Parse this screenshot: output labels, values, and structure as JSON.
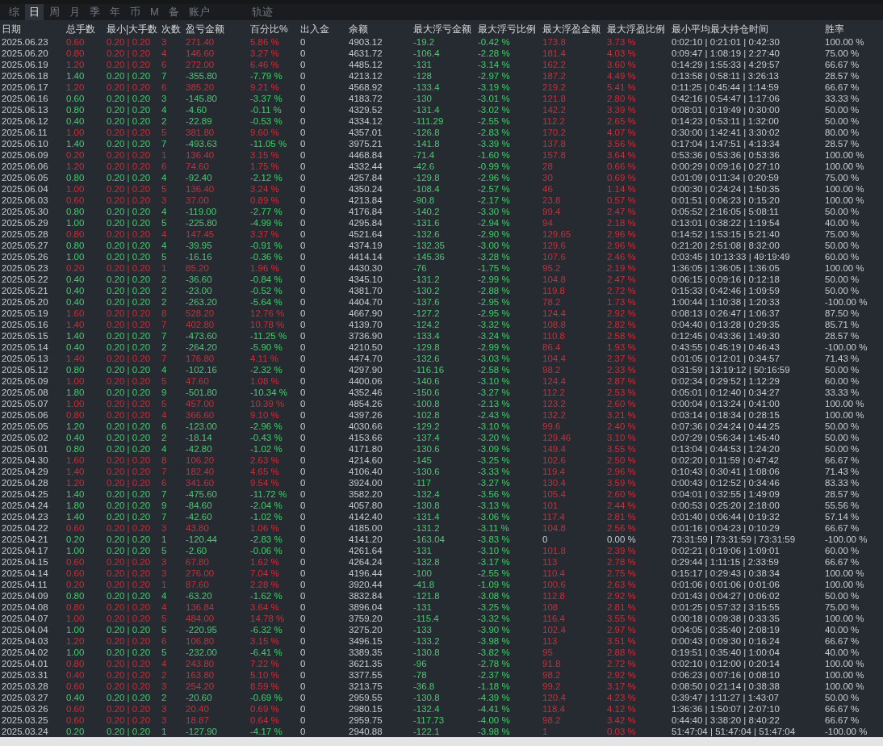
{
  "tabs": [
    {
      "label": "综",
      "selected": false
    },
    {
      "label": "日",
      "selected": true
    },
    {
      "label": "周",
      "selected": false
    },
    {
      "label": "月",
      "selected": false
    },
    {
      "label": "季",
      "selected": false
    },
    {
      "label": "年",
      "selected": false
    },
    {
      "label": "币",
      "selected": false
    },
    {
      "label": "M",
      "selected": false
    },
    {
      "label": "备",
      "selected": false
    },
    {
      "label": "账户",
      "selected": false
    }
  ],
  "extra_tab": {
    "label": "轨迹",
    "selected": false
  },
  "table": {
    "columns": [
      "日期",
      "总手数",
      "最小|大手数",
      "次数",
      "盈亏金额",
      "百分比%",
      "出入金",
      "余额",
      "最大浮亏金额",
      "最大浮亏比例",
      "最大浮盈金额",
      "最大浮盈比例",
      "最小平均最大持仓时间",
      "胜率"
    ],
    "rows": [
      {
        "kind": "win",
        "float_flat": false,
        "cells": [
          "2025.06.23",
          "0.60",
          "0.20 | 0.20",
          "3",
          "271.40",
          "5.86 %",
          "0",
          "4903.12",
          "-19.2",
          "-0.42 %",
          "173.8",
          "3.73 %",
          "0:02:10 | 0:21:01 | 0:42:30",
          "100.00 %"
        ]
      },
      {
        "kind": "win",
        "float_flat": false,
        "cells": [
          "2025.06.20",
          "0.80",
          "0.20 | 0.20",
          "4",
          "146.60",
          "3.27 %",
          "0",
          "4631.72",
          "-106.4",
          "-2.28 %",
          "181.4",
          "4.03 %",
          "0:09:47 | 1:08:19 | 2:27:40",
          "75.00 %"
        ]
      },
      {
        "kind": "win",
        "float_flat": false,
        "cells": [
          "2025.06.19",
          "1.20",
          "0.20 | 0.20",
          "6",
          "272.00",
          "6.46 %",
          "0",
          "4485.12",
          "-131",
          "-3.14 %",
          "162.2",
          "3.60 %",
          "0:14:29 | 1:55:33 | 4:29:57",
          "66.67 %"
        ]
      },
      {
        "kind": "loss",
        "float_flat": false,
        "cells": [
          "2025.06.18",
          "1.40",
          "0.20 | 0.20",
          "7",
          "-355.80",
          "-7.79 %",
          "0",
          "4213.12",
          "-128",
          "-2.97 %",
          "187.2",
          "4.49 %",
          "0:13:58 | 0:58:11 | 3:26:13",
          "28.57 %"
        ]
      },
      {
        "kind": "win",
        "float_flat": false,
        "cells": [
          "2025.06.17",
          "1.20",
          "0.20 | 0.20",
          "6",
          "385.20",
          "9.21 %",
          "0",
          "4568.92",
          "-133.4",
          "-3.19 %",
          "219.2",
          "5.41 %",
          "0:11:25 | 0:45:44 | 1:14:59",
          "66.67 %"
        ]
      },
      {
        "kind": "loss",
        "float_flat": false,
        "cells": [
          "2025.06.16",
          "0.60",
          "0.20 | 0.20",
          "3",
          "-145.80",
          "-3.37 %",
          "0",
          "4183.72",
          "-130",
          "-3.01 %",
          "121.8",
          "2.80 %",
          "0:42:16 | 0:54:47 | 1:17:06",
          "33.33 %"
        ]
      },
      {
        "kind": "loss",
        "float_flat": false,
        "cells": [
          "2025.06.13",
          "0.80",
          "0.20 | 0.20",
          "4",
          "-4.60",
          "-0.11 %",
          "0",
          "4329.52",
          "-131.4",
          "-3.02 %",
          "142.2",
          "3.39 %",
          "0:08:01 | 0:19:49 | 0:30:00",
          "50.00 %"
        ]
      },
      {
        "kind": "loss",
        "float_flat": false,
        "cells": [
          "2025.06.12",
          "0.40",
          "0.20 | 0.20",
          "2",
          "-22.89",
          "-0.53 %",
          "0",
          "4334.12",
          "-111.29",
          "-2.55 %",
          "112.2",
          "2.65 %",
          "0:14:23 | 0:53:11 | 1:32:00",
          "50.00 %"
        ]
      },
      {
        "kind": "win",
        "float_flat": false,
        "cells": [
          "2025.06.11",
          "1.00",
          "0.20 | 0.20",
          "5",
          "381.80",
          "9.60 %",
          "0",
          "4357.01",
          "-126.8",
          "-2.83 %",
          "170.2",
          "4.07 %",
          "0:30:00 | 1:42:41 | 3:30:02",
          "80.00 %"
        ]
      },
      {
        "kind": "loss",
        "float_flat": false,
        "cells": [
          "2025.06.10",
          "1.40",
          "0.20 | 0.20",
          "7",
          "-493.63",
          "-11.05 %",
          "0",
          "3975.21",
          "-141.8",
          "-3.39 %",
          "137.8",
          "3.56 %",
          "0:17:04 | 1:47:51 | 4:13:34",
          "28.57 %"
        ]
      },
      {
        "kind": "win",
        "float_flat": false,
        "cells": [
          "2025.06.09",
          "0.20",
          "0.20 | 0.20",
          "1",
          "136.40",
          "3.15 %",
          "0",
          "4468.84",
          "-71.4",
          "-1.60 %",
          "157.8",
          "3.64 %",
          "0:53:36 | 0:53:36 | 0:53:36",
          "100.00 %"
        ]
      },
      {
        "kind": "win",
        "float_flat": false,
        "cells": [
          "2025.06.06",
          "1.20",
          "0.20 | 0.20",
          "6",
          "74.60",
          "1.75 %",
          "0",
          "4332.44",
          "-42.6",
          "-0.99 %",
          "28",
          "0.66 %",
          "0:00:29 | 0:09:16 | 0:27:10",
          "100.00 %"
        ]
      },
      {
        "kind": "loss",
        "float_flat": false,
        "cells": [
          "2025.06.05",
          "0.80",
          "0.20 | 0.20",
          "4",
          "-92.40",
          "-2.12 %",
          "0",
          "4257.84",
          "-129.8",
          "-2.96 %",
          "30",
          "0.69 %",
          "0:01:09 | 0:11:34 | 0:20:59",
          "75.00 %"
        ]
      },
      {
        "kind": "win",
        "float_flat": false,
        "cells": [
          "2025.06.04",
          "1.00",
          "0.20 | 0.20",
          "5",
          "136.40",
          "3.24 %",
          "0",
          "4350.24",
          "-108.4",
          "-2.57 %",
          "46",
          "1.14 %",
          "0:00:30 | 0:24:24 | 1:50:35",
          "100.00 %"
        ]
      },
      {
        "kind": "win",
        "float_flat": false,
        "cells": [
          "2025.06.03",
          "0.60",
          "0.20 | 0.20",
          "3",
          "37.00",
          "0.89 %",
          "0",
          "4213.84",
          "-90.8",
          "-2.17 %",
          "23.8",
          "0.57 %",
          "0:01:51 | 0:06:23 | 0:15:20",
          "100.00 %"
        ]
      },
      {
        "kind": "loss",
        "float_flat": false,
        "cells": [
          "2025.05.30",
          "0.80",
          "0.20 | 0.20",
          "4",
          "-119.00",
          "-2.77 %",
          "0",
          "4176.84",
          "-140.2",
          "-3.30 %",
          "99.4",
          "2.47 %",
          "0:05:52 | 2:16:05 | 5:08:11",
          "50.00 %"
        ]
      },
      {
        "kind": "loss",
        "float_flat": false,
        "cells": [
          "2025.05.29",
          "1.00",
          "0.20 | 0.20",
          "5",
          "-225.80",
          "-4.99 %",
          "0",
          "4295.84",
          "-131.6",
          "-2.94 %",
          "94",
          "2.18 %",
          "0:13:01 | 0:38:22 | 1:19:54",
          "40.00 %"
        ]
      },
      {
        "kind": "win",
        "float_flat": false,
        "cells": [
          "2025.05.28",
          "0.80",
          "0.20 | 0.20",
          "4",
          "147.45",
          "3.37 %",
          "0",
          "4521.64",
          "-132.6",
          "-2.90 %",
          "129.65",
          "2.96 %",
          "0:14:52 | 1:53:15 | 5:21:40",
          "75.00 %"
        ]
      },
      {
        "kind": "loss",
        "float_flat": false,
        "cells": [
          "2025.05.27",
          "0.80",
          "0.20 | 0.20",
          "4",
          "-39.95",
          "-0.91 %",
          "0",
          "4374.19",
          "-132.35",
          "-3.00 %",
          "129.6",
          "2.96 %",
          "0:21:20 | 2:51:08 | 8:32:00",
          "50.00 %"
        ]
      },
      {
        "kind": "loss",
        "float_flat": false,
        "cells": [
          "2025.05.26",
          "1.00",
          "0.20 | 0.20",
          "5",
          "-16.16",
          "-0.36 %",
          "0",
          "4414.14",
          "-145.36",
          "-3.28 %",
          "107.6",
          "2.46 %",
          "0:03:45 | 10:13:33 | 49:19:49",
          "60.00 %"
        ]
      },
      {
        "kind": "win",
        "float_flat": false,
        "cells": [
          "2025.05.23",
          "0.20",
          "0.20 | 0.20",
          "1",
          "85.20",
          "1.96 %",
          "0",
          "4430.30",
          "-76",
          "-1.75 %",
          "95.2",
          "2.19 %",
          "1:36:05 | 1:36:05 | 1:36:05",
          "100.00 %"
        ]
      },
      {
        "kind": "loss",
        "float_flat": false,
        "cells": [
          "2025.05.22",
          "0.40",
          "0.20 | 0.20",
          "2",
          "-36.60",
          "-0.84 %",
          "0",
          "4345.10",
          "-131.2",
          "-2.99 %",
          "104.8",
          "2.47 %",
          "0:06:15 | 0:09:16 | 0:12:18",
          "50.00 %"
        ]
      },
      {
        "kind": "loss",
        "float_flat": false,
        "cells": [
          "2025.05.21",
          "0.40",
          "0.20 | 0.20",
          "2",
          "-23.00",
          "-0.52 %",
          "0",
          "4381.70",
          "-130.2",
          "-2.88 %",
          "119.8",
          "2.72 %",
          "0:15:33 | 0:42:46 | 1:09:59",
          "50.00 %"
        ]
      },
      {
        "kind": "loss",
        "float_flat": false,
        "cells": [
          "2025.05.20",
          "0.40",
          "0.20 | 0.20",
          "2",
          "-263.20",
          "-5.64 %",
          "0",
          "4404.70",
          "-137.6",
          "-2.95 %",
          "78.2",
          "1.73 %",
          "1:00:44 | 1:10:38 | 1:20:33",
          "-100.00 %"
        ]
      },
      {
        "kind": "win",
        "float_flat": false,
        "cells": [
          "2025.05.19",
          "1.60",
          "0.20 | 0.20",
          "8",
          "528.20",
          "12.76 %",
          "0",
          "4667.90",
          "-127.2",
          "-2.95 %",
          "124.4",
          "2.92 %",
          "0:08:13 | 0:26:47 | 1:06:37",
          "87.50 %"
        ]
      },
      {
        "kind": "win",
        "float_flat": false,
        "cells": [
          "2025.05.16",
          "1.40",
          "0.20 | 0.20",
          "7",
          "402.80",
          "10.78 %",
          "0",
          "4139.70",
          "-124.2",
          "-3.32 %",
          "108.8",
          "2.82 %",
          "0:04:40 | 0:13:28 | 0:29:35",
          "85.71 %"
        ]
      },
      {
        "kind": "loss",
        "float_flat": false,
        "cells": [
          "2025.05.15",
          "1.40",
          "0.20 | 0.20",
          "7",
          "-473.60",
          "-11.25 %",
          "0",
          "3736.90",
          "-133.4",
          "-3.24 %",
          "110.8",
          "2.58 %",
          "0:12:45 | 0:43:36 | 1:49:30",
          "28.57 %"
        ]
      },
      {
        "kind": "loss",
        "float_flat": false,
        "cells": [
          "2025.05.14",
          "0.40",
          "0.20 | 0.20",
          "2",
          "-264.20",
          "-5.90 %",
          "0",
          "4210.50",
          "-129.8",
          "-2.99 %",
          "86.4",
          "1.93 %",
          "0:43:55 | 0:45:19 | 0:46:43",
          "-100.00 %"
        ]
      },
      {
        "kind": "win",
        "float_flat": false,
        "cells": [
          "2025.05.13",
          "1.40",
          "0.20 | 0.20",
          "7",
          "176.80",
          "4.11 %",
          "0",
          "4474.70",
          "-132.6",
          "-3.03 %",
          "104.4",
          "2.37 %",
          "0:01:05 | 0:12:01 | 0:34:57",
          "71.43 %"
        ]
      },
      {
        "kind": "loss",
        "float_flat": false,
        "cells": [
          "2025.05.12",
          "0.80",
          "0.20 | 0.20",
          "4",
          "-102.16",
          "-2.32 %",
          "0",
          "4297.90",
          "-116.16",
          "-2.58 %",
          "98.2",
          "2.33 %",
          "0:31:59 | 13:19:12 | 50:16:59",
          "50.00 %"
        ]
      },
      {
        "kind": "win",
        "float_flat": false,
        "cells": [
          "2025.05.09",
          "1.00",
          "0.20 | 0.20",
          "5",
          "47.60",
          "1.08 %",
          "0",
          "4400.06",
          "-140.6",
          "-3.10 %",
          "124.4",
          "2.87 %",
          "0:02:34 | 0:29:52 | 1:12:29",
          "60.00 %"
        ]
      },
      {
        "kind": "loss",
        "float_flat": false,
        "cells": [
          "2025.05.08",
          "1.80",
          "0.20 | 0.20",
          "9",
          "-501.80",
          "-10.34 %",
          "0",
          "4352.46",
          "-150.6",
          "-3.27 %",
          "112.2",
          "2.53 %",
          "0:05:01 | 0:12:40 | 0:34:27",
          "33.33 %"
        ]
      },
      {
        "kind": "win",
        "float_flat": false,
        "cells": [
          "2025.05.07",
          "1.00",
          "0.20 | 0.20",
          "5",
          "457.00",
          "10.39 %",
          "0",
          "4854.26",
          "-100.8",
          "-2.13 %",
          "123.2",
          "2.60 %",
          "0:00:04 | 0:13:24 | 0:41:00",
          "100.00 %"
        ]
      },
      {
        "kind": "win",
        "float_flat": false,
        "cells": [
          "2025.05.06",
          "0.80",
          "0.20 | 0.20",
          "4",
          "366.60",
          "9.10 %",
          "0",
          "4397.26",
          "-102.8",
          "-2.43 %",
          "132.2",
          "3.21 %",
          "0:03:14 | 0:18:34 | 0:28:15",
          "100.00 %"
        ]
      },
      {
        "kind": "loss",
        "float_flat": false,
        "cells": [
          "2025.05.05",
          "1.20",
          "0.20 | 0.20",
          "6",
          "-123.00",
          "-2.96 %",
          "0",
          "4030.66",
          "-129.2",
          "-3.10 %",
          "99.6",
          "2.40 %",
          "0:07:36 | 0:24:24 | 0:44:25",
          "50.00 %"
        ]
      },
      {
        "kind": "loss",
        "float_flat": false,
        "cells": [
          "2025.05.02",
          "0.40",
          "0.20 | 0.20",
          "2",
          "-18.14",
          "-0.43 %",
          "0",
          "4153.66",
          "-137.4",
          "-3.20 %",
          "129.46",
          "3.10 %",
          "0:07:29 | 0:56:34 | 1:45:40",
          "50.00 %"
        ]
      },
      {
        "kind": "loss",
        "float_flat": false,
        "cells": [
          "2025.05.01",
          "0.80",
          "0.20 | 0.20",
          "4",
          "-42.80",
          "-1.02 %",
          "0",
          "4171.80",
          "-130.6",
          "-3.09 %",
          "149.4",
          "3.55 %",
          "0:13:04 | 0:44:53 | 1:24:20",
          "50.00 %"
        ]
      },
      {
        "kind": "win",
        "float_flat": false,
        "cells": [
          "2025.04.30",
          "1.60",
          "0.20 | 0.20",
          "8",
          "106.20",
          "2.63 %",
          "0",
          "4214.60",
          "-145",
          "-3.25 %",
          "102.6",
          "2.50 %",
          "0:02:20 | 0:11:59 | 0:47:42",
          "66.67 %"
        ]
      },
      {
        "kind": "win",
        "float_flat": false,
        "cells": [
          "2025.04.29",
          "1.40",
          "0.20 | 0.20",
          "7",
          "182.40",
          "4.65 %",
          "0",
          "4106.40",
          "-130.6",
          "-3.33 %",
          "119.4",
          "2.96 %",
          "0:10:43 | 0:30:41 | 1:08:06",
          "71.43 %"
        ]
      },
      {
        "kind": "win",
        "float_flat": false,
        "cells": [
          "2025.04.28",
          "1.20",
          "0.20 | 0.20",
          "6",
          "341.60",
          "9.54 %",
          "0",
          "3924.00",
          "-117",
          "-3.27 %",
          "130.4",
          "3.59 %",
          "0:00:43 | 0:12:52 | 0:34:46",
          "83.33 %"
        ]
      },
      {
        "kind": "loss",
        "float_flat": false,
        "cells": [
          "2025.04.25",
          "1.40",
          "0.20 | 0.20",
          "7",
          "-475.60",
          "-11.72 %",
          "0",
          "3582.20",
          "-132.4",
          "-3.56 %",
          "105.4",
          "2.60 %",
          "0:04:01 | 0:32:55 | 1:49:09",
          "28.57 %"
        ]
      },
      {
        "kind": "loss",
        "float_flat": false,
        "cells": [
          "2025.04.24",
          "1.80",
          "0.20 | 0.20",
          "9",
          "-84.60",
          "-2.04 %",
          "0",
          "4057.80",
          "-130.8",
          "-3.13 %",
          "101",
          "2.44 %",
          "0:00:53 | 0:25:20 | 2:18:00",
          "55.56 %"
        ]
      },
      {
        "kind": "loss",
        "float_flat": false,
        "cells": [
          "2025.04.23",
          "1.40",
          "0.20 | 0.20",
          "7",
          "-42.60",
          "-1.02 %",
          "0",
          "4142.40",
          "-131.4",
          "-3.06 %",
          "117.4",
          "2.81 %",
          "0:01:40 | 0:06:44 | 0:19:32",
          "57.14 %"
        ]
      },
      {
        "kind": "win",
        "float_flat": false,
        "cells": [
          "2025.04.22",
          "0.60",
          "0.20 | 0.20",
          "3",
          "43.80",
          "1.06 %",
          "0",
          "4185.00",
          "-131.2",
          "-3.11 %",
          "104.8",
          "2.56 %",
          "0:01:16 | 0:04:23 | 0:10:29",
          "66.67 %"
        ]
      },
      {
        "kind": "loss",
        "float_flat": true,
        "cells": [
          "2025.04.21",
          "0.20",
          "0.20 | 0.20",
          "1",
          "-120.44",
          "-2.83 %",
          "0",
          "4141.20",
          "-163.04",
          "-3.83 %",
          "0",
          "0.00 %",
          "73:31:59 | 73:31:59 | 73:31:59",
          "-100.00 %"
        ]
      },
      {
        "kind": "loss",
        "float_flat": false,
        "cells": [
          "2025.04.17",
          "1.00",
          "0.20 | 0.20",
          "5",
          "-2.60",
          "-0.06 %",
          "0",
          "4261.64",
          "-131",
          "-3.10 %",
          "101.8",
          "2.39 %",
          "0:02:21 | 0:19:06 | 1:09:01",
          "60.00 %"
        ]
      },
      {
        "kind": "win",
        "float_flat": false,
        "cells": [
          "2025.04.15",
          "0.60",
          "0.20 | 0.20",
          "3",
          "67.80",
          "1.62 %",
          "0",
          "4264.24",
          "-132.8",
          "-3.17 %",
          "113",
          "2.78 %",
          "0:29:44 | 1:11:15 | 2:33:59",
          "66.67 %"
        ]
      },
      {
        "kind": "win",
        "float_flat": false,
        "cells": [
          "2025.04.14",
          "0.60",
          "0.20 | 0.20",
          "3",
          "276.00",
          "7.04 %",
          "0",
          "4196.44",
          "-100",
          "-2.55 %",
          "110.4",
          "2.75 %",
          "0:15:17 | 0:29:43 | 0:38:34",
          "100.00 %"
        ]
      },
      {
        "kind": "win",
        "float_flat": false,
        "cells": [
          "2025.04.11",
          "0.20",
          "0.20 | 0.20",
          "1",
          "87.60",
          "2.28 %",
          "0",
          "3920.44",
          "-41.8",
          "-1.09 %",
          "100.6",
          "2.63 %",
          "0:01:06 | 0:01:06 | 0:01:06",
          "100.00 %"
        ]
      },
      {
        "kind": "loss",
        "float_flat": false,
        "cells": [
          "2025.04.09",
          "0.80",
          "0.20 | 0.20",
          "4",
          "-63.20",
          "-1.62 %",
          "0",
          "3832.84",
          "-121.8",
          "-3.08 %",
          "112.8",
          "2.92 %",
          "0:01:43 | 0:04:27 | 0:06:02",
          "50.00 %"
        ]
      },
      {
        "kind": "win",
        "float_flat": false,
        "cells": [
          "2025.04.08",
          "0.80",
          "0.20 | 0.20",
          "4",
          "136.84",
          "3.64 %",
          "0",
          "3896.04",
          "-131",
          "-3.25 %",
          "108",
          "2.81 %",
          "0:01:25 | 0:57:32 | 3:15:55",
          "75.00 %"
        ]
      },
      {
        "kind": "win",
        "float_flat": false,
        "cells": [
          "2025.04.07",
          "1.00",
          "0.20 | 0.20",
          "5",
          "484.00",
          "14.78 %",
          "0",
          "3759.20",
          "-115.4",
          "-3.32 %",
          "116.4",
          "3.55 %",
          "0:00:18 | 0:09:38 | 0:33:35",
          "100.00 %"
        ]
      },
      {
        "kind": "loss",
        "float_flat": false,
        "cells": [
          "2025.04.04",
          "1.00",
          "0.20 | 0.20",
          "5",
          "-220.95",
          "-6.32 %",
          "0",
          "3275.20",
          "-133",
          "-3.90 %",
          "102.4",
          "2.97 %",
          "0:04:05 | 0:35:40 | 2:08:19",
          "40.00 %"
        ]
      },
      {
        "kind": "win",
        "float_flat": false,
        "cells": [
          "2025.04.03",
          "1.20",
          "0.20 | 0.20",
          "6",
          "106.80",
          "3.15 %",
          "0",
          "3496.15",
          "-133.2",
          "-3.98 %",
          "113",
          "3.51 %",
          "0:00:43 | 0:09:30 | 0:16:24",
          "66.67 %"
        ]
      },
      {
        "kind": "loss",
        "float_flat": false,
        "cells": [
          "2025.04.02",
          "1.00",
          "0.20 | 0.20",
          "5",
          "-232.00",
          "-6.41 %",
          "0",
          "3389.35",
          "-130.8",
          "-3.82 %",
          "95",
          "2.88 %",
          "0:19:51 | 0:35:40 | 1:00:04",
          "40.00 %"
        ]
      },
      {
        "kind": "win",
        "float_flat": false,
        "cells": [
          "2025.04.01",
          "0.80",
          "0.20 | 0.20",
          "4",
          "243.80",
          "7.22 %",
          "0",
          "3621.35",
          "-96",
          "-2.78 %",
          "91.8",
          "2.72 %",
          "0:02:10 | 0:12:00 | 0:20:14",
          "100.00 %"
        ]
      },
      {
        "kind": "win",
        "float_flat": false,
        "cells": [
          "2025.03.31",
          "0.40",
          "0.20 | 0.20",
          "2",
          "163.80",
          "5.10 %",
          "0",
          "3377.55",
          "-78",
          "-2.37 %",
          "98.2",
          "2.92 %",
          "0:06:23 | 0:07:16 | 0:08:10",
          "100.00 %"
        ]
      },
      {
        "kind": "win",
        "float_flat": false,
        "cells": [
          "2025.03.28",
          "0.60",
          "0.20 | 0.20",
          "3",
          "254.20",
          "8.59 %",
          "0",
          "3213.75",
          "-36.8",
          "-1.18 %",
          "99.2",
          "3.17 %",
          "0:08:50 | 0:21:14 | 0:38:38",
          "100.00 %"
        ]
      },
      {
        "kind": "loss",
        "float_flat": false,
        "cells": [
          "2025.03.27",
          "0.40",
          "0.20 | 0.20",
          "2",
          "-20.60",
          "-0.69 %",
          "0",
          "2959.55",
          "-130.8",
          "-4.39 %",
          "120.4",
          "4.23 %",
          "0:39:47 | 1:11:27 | 1:43:07",
          "50.00 %"
        ]
      },
      {
        "kind": "win",
        "float_flat": false,
        "cells": [
          "2025.03.26",
          "0.60",
          "0.20 | 0.20",
          "3",
          "20.40",
          "0.69 %",
          "0",
          "2980.15",
          "-132.4",
          "-4.41 %",
          "118.4",
          "4.12 %",
          "1:36:36 | 1:50:07 | 2:07:10",
          "66.67 %"
        ]
      },
      {
        "kind": "win",
        "float_flat": false,
        "cells": [
          "2025.03.25",
          "0.60",
          "0.20 | 0.20",
          "3",
          "18.87",
          "0.64 %",
          "0",
          "2959.75",
          "-117.73",
          "-4.00 %",
          "98.2",
          "3.42 %",
          "0:44:40 | 3:38:20 | 8:40:22",
          "66.67 %"
        ]
      },
      {
        "kind": "loss",
        "float_flat": false,
        "cells": [
          "2025.03.24",
          "0.20",
          "0.20 | 0.20",
          "1",
          "-127.90",
          "-4.17 %",
          "0",
          "2940.88",
          "-122.1",
          "-3.98 %",
          "1",
          "0.03 %",
          "51:47:04 | 51:47:04 | 51:47:04",
          "-100.00 %"
        ]
      }
    ]
  }
}
